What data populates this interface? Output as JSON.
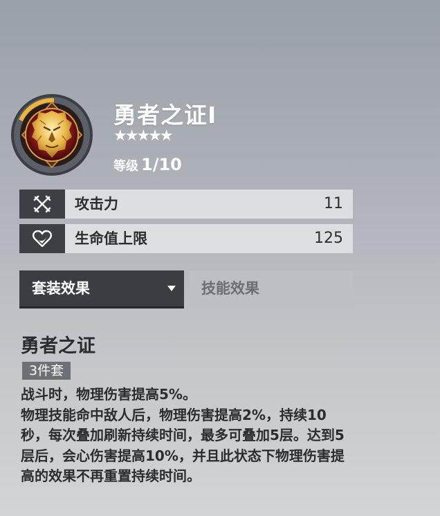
{
  "item": {
    "name": "勇者之证I",
    "stars": "★★★★★",
    "level_label": "等级",
    "level_value": "1/10",
    "badge_icon": "lion-emblem-icon"
  },
  "stats": [
    {
      "icon": "crossed-swords-icon",
      "label": "攻击力",
      "value": "11"
    },
    {
      "icon": "heart-icon",
      "label": "生命值上限",
      "value": "125"
    }
  ],
  "tabs": {
    "set_effect": "套装效果",
    "skill_effect": "技能效果",
    "active": "set_effect"
  },
  "set": {
    "name": "勇者之证",
    "pieces": "3件套",
    "lines": [
      "战斗时，物理伤害提高5%。",
      "物理技能命中敌人后，物理伤害提高2%，持续10秒，每次叠加刷新持续时间，最多可叠加5层。达到5层后，会心伤害提高10%，并且此状态下物理伤害提高的效果不再重置持续时间。"
    ]
  },
  "colors": {
    "tab_active": "#3a3d42",
    "icon_box": "#3c3f44",
    "text_dark": "#2a2c30",
    "badge_gold": "#e0a53a",
    "badge_red": "#8c1a1a"
  }
}
